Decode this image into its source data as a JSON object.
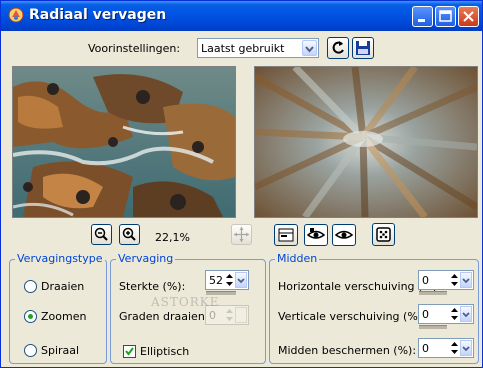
{
  "window": {
    "title": "Radiaal vervagen"
  },
  "presets": {
    "label": "Voorinstellingen:",
    "value": "Laatst gebruikt"
  },
  "zoom": {
    "value": "22,1%"
  },
  "watermark": "ASTORKE",
  "blur_type": {
    "title": "Vervagingstype",
    "options": [
      {
        "label": "Draaien",
        "selected": false
      },
      {
        "label": "Zoomen",
        "selected": true
      },
      {
        "label": "Spiraal",
        "selected": false
      }
    ]
  },
  "blur": {
    "title": "Vervaging",
    "strength_label": "Sterkte (%):",
    "strength_value": "52",
    "twist_label": "Graden draaien:",
    "twist_value": "0",
    "elliptical_label": "Elliptisch",
    "elliptical_checked": true
  },
  "center": {
    "title": "Midden",
    "h_offset_label": "Horizontale verschuiving (%):",
    "h_offset_value": "0",
    "v_offset_label": "Verticale verschuiving (%):",
    "v_offset_value": "0",
    "protect_label": "Midden beschermen (%):",
    "protect_value": "0"
  },
  "colors": {
    "accent": "#0046d5",
    "titlebar": "#0055e5",
    "dialog_bg": "#ece9d8"
  }
}
